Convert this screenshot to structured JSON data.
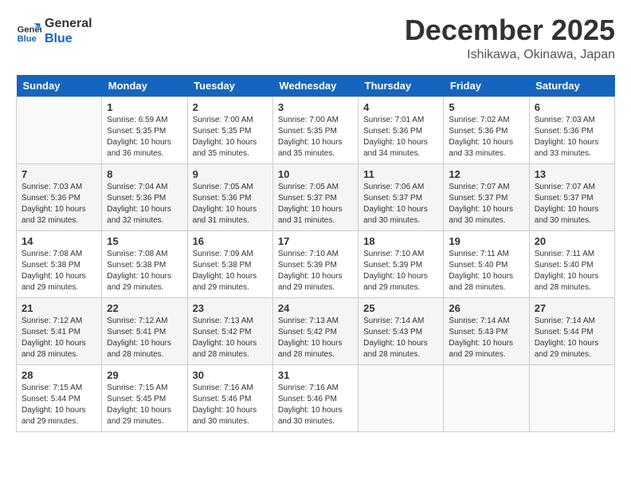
{
  "header": {
    "logo_line1": "General",
    "logo_line2": "Blue",
    "month": "December 2025",
    "location": "Ishikawa, Okinawa, Japan"
  },
  "days_of_week": [
    "Sunday",
    "Monday",
    "Tuesday",
    "Wednesday",
    "Thursday",
    "Friday",
    "Saturday"
  ],
  "weeks": [
    [
      {
        "day": "",
        "info": ""
      },
      {
        "day": "1",
        "info": "Sunrise: 6:59 AM\nSunset: 5:35 PM\nDaylight: 10 hours\nand 36 minutes."
      },
      {
        "day": "2",
        "info": "Sunrise: 7:00 AM\nSunset: 5:35 PM\nDaylight: 10 hours\nand 35 minutes."
      },
      {
        "day": "3",
        "info": "Sunrise: 7:00 AM\nSunset: 5:35 PM\nDaylight: 10 hours\nand 35 minutes."
      },
      {
        "day": "4",
        "info": "Sunrise: 7:01 AM\nSunset: 5:36 PM\nDaylight: 10 hours\nand 34 minutes."
      },
      {
        "day": "5",
        "info": "Sunrise: 7:02 AM\nSunset: 5:36 PM\nDaylight: 10 hours\nand 33 minutes."
      },
      {
        "day": "6",
        "info": "Sunrise: 7:03 AM\nSunset: 5:36 PM\nDaylight: 10 hours\nand 33 minutes."
      }
    ],
    [
      {
        "day": "7",
        "info": "Sunrise: 7:03 AM\nSunset: 5:36 PM\nDaylight: 10 hours\nand 32 minutes."
      },
      {
        "day": "8",
        "info": "Sunrise: 7:04 AM\nSunset: 5:36 PM\nDaylight: 10 hours\nand 32 minutes."
      },
      {
        "day": "9",
        "info": "Sunrise: 7:05 AM\nSunset: 5:36 PM\nDaylight: 10 hours\nand 31 minutes."
      },
      {
        "day": "10",
        "info": "Sunrise: 7:05 AM\nSunset: 5:37 PM\nDaylight: 10 hours\nand 31 minutes."
      },
      {
        "day": "11",
        "info": "Sunrise: 7:06 AM\nSunset: 5:37 PM\nDaylight: 10 hours\nand 30 minutes."
      },
      {
        "day": "12",
        "info": "Sunrise: 7:07 AM\nSunset: 5:37 PM\nDaylight: 10 hours\nand 30 minutes."
      },
      {
        "day": "13",
        "info": "Sunrise: 7:07 AM\nSunset: 5:37 PM\nDaylight: 10 hours\nand 30 minutes."
      }
    ],
    [
      {
        "day": "14",
        "info": "Sunrise: 7:08 AM\nSunset: 5:38 PM\nDaylight: 10 hours\nand 29 minutes."
      },
      {
        "day": "15",
        "info": "Sunrise: 7:08 AM\nSunset: 5:38 PM\nDaylight: 10 hours\nand 29 minutes."
      },
      {
        "day": "16",
        "info": "Sunrise: 7:09 AM\nSunset: 5:38 PM\nDaylight: 10 hours\nand 29 minutes."
      },
      {
        "day": "17",
        "info": "Sunrise: 7:10 AM\nSunset: 5:39 PM\nDaylight: 10 hours\nand 29 minutes."
      },
      {
        "day": "18",
        "info": "Sunrise: 7:10 AM\nSunset: 5:39 PM\nDaylight: 10 hours\nand 29 minutes."
      },
      {
        "day": "19",
        "info": "Sunrise: 7:11 AM\nSunset: 5:40 PM\nDaylight: 10 hours\nand 28 minutes."
      },
      {
        "day": "20",
        "info": "Sunrise: 7:11 AM\nSunset: 5:40 PM\nDaylight: 10 hours\nand 28 minutes."
      }
    ],
    [
      {
        "day": "21",
        "info": "Sunrise: 7:12 AM\nSunset: 5:41 PM\nDaylight: 10 hours\nand 28 minutes."
      },
      {
        "day": "22",
        "info": "Sunrise: 7:12 AM\nSunset: 5:41 PM\nDaylight: 10 hours\nand 28 minutes."
      },
      {
        "day": "23",
        "info": "Sunrise: 7:13 AM\nSunset: 5:42 PM\nDaylight: 10 hours\nand 28 minutes."
      },
      {
        "day": "24",
        "info": "Sunrise: 7:13 AM\nSunset: 5:42 PM\nDaylight: 10 hours\nand 28 minutes."
      },
      {
        "day": "25",
        "info": "Sunrise: 7:14 AM\nSunset: 5:43 PM\nDaylight: 10 hours\nand 28 minutes."
      },
      {
        "day": "26",
        "info": "Sunrise: 7:14 AM\nSunset: 5:43 PM\nDaylight: 10 hours\nand 29 minutes."
      },
      {
        "day": "27",
        "info": "Sunrise: 7:14 AM\nSunset: 5:44 PM\nDaylight: 10 hours\nand 29 minutes."
      }
    ],
    [
      {
        "day": "28",
        "info": "Sunrise: 7:15 AM\nSunset: 5:44 PM\nDaylight: 10 hours\nand 29 minutes."
      },
      {
        "day": "29",
        "info": "Sunrise: 7:15 AM\nSunset: 5:45 PM\nDaylight: 10 hours\nand 29 minutes."
      },
      {
        "day": "30",
        "info": "Sunrise: 7:16 AM\nSunset: 5:46 PM\nDaylight: 10 hours\nand 30 minutes."
      },
      {
        "day": "31",
        "info": "Sunrise: 7:16 AM\nSunset: 5:46 PM\nDaylight: 10 hours\nand 30 minutes."
      },
      {
        "day": "",
        "info": ""
      },
      {
        "day": "",
        "info": ""
      },
      {
        "day": "",
        "info": ""
      }
    ]
  ]
}
